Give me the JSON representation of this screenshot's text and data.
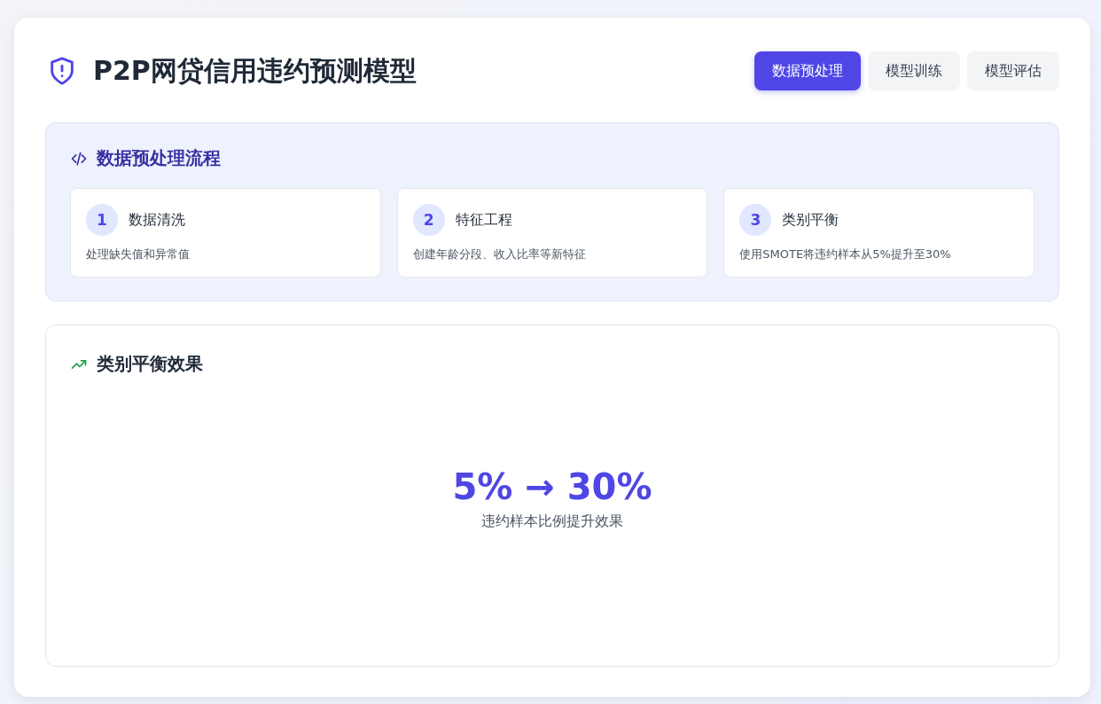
{
  "header": {
    "title": "P2P网贷信用违约预测模型"
  },
  "tabs": [
    {
      "label": "数据预处理",
      "selected": true
    },
    {
      "label": "模型训练",
      "selected": false
    },
    {
      "label": "模型评估",
      "selected": false
    }
  ],
  "pipeline": {
    "title": "数据预处理流程",
    "steps": [
      {
        "number": "1",
        "title": "数据清洗",
        "description": "处理缺失值和异常值"
      },
      {
        "number": "2",
        "title": "特征工程",
        "description": "创建年龄分段、收入比率等新特征"
      },
      {
        "number": "3",
        "title": "类别平衡",
        "description": "使用SMOTE将违约样本从5%提升至30%"
      }
    ]
  },
  "balance": {
    "title": "类别平衡效果",
    "result": "5% → 30%",
    "caption": "违约样本比例提升效果"
  }
}
